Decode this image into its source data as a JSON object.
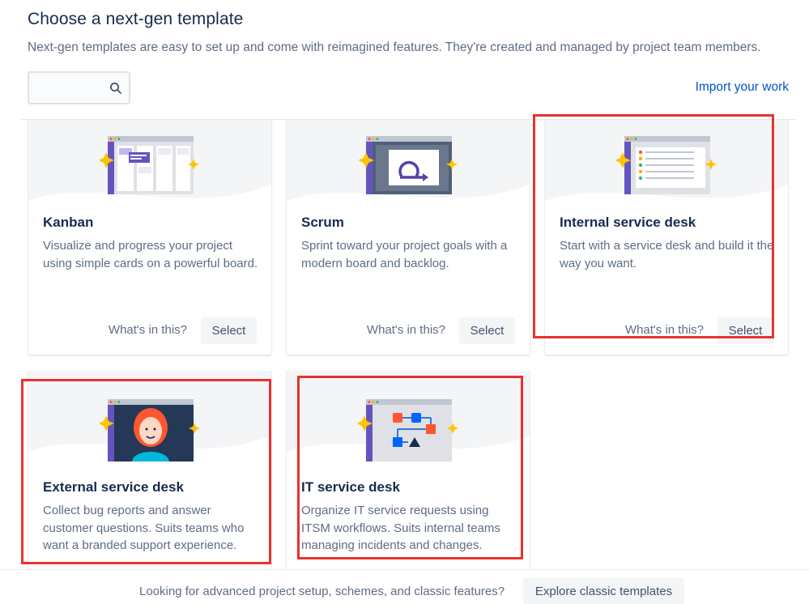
{
  "header": {
    "title": "Choose a next-gen template",
    "subtitle": "Next-gen templates are easy to set up and come with reimagined features. They're created and managed by project team members."
  },
  "search": {
    "value": "",
    "placeholder": "",
    "icon": "search-icon"
  },
  "import_link": "Import your work",
  "cards": [
    {
      "title": "Kanban",
      "description": "Visualize and progress your project using simple cards on a powerful board.",
      "whats_in": "What's in this?",
      "select": "Select",
      "icon": "kanban-board-illustration"
    },
    {
      "title": "Scrum",
      "description": "Sprint toward your project goals with a modern board and backlog.",
      "whats_in": "What's in this?",
      "select": "Select",
      "icon": "scrum-sprint-illustration"
    },
    {
      "title": "Internal service desk",
      "description": "Start with a service desk and build it the way you want.",
      "whats_in": "What's in this?",
      "select": "Select",
      "icon": "service-desk-list-illustration"
    },
    {
      "title": "External service desk",
      "description": "Collect bug reports and answer customer questions. Suits teams who want a branded support experience.",
      "icon": "customer-avatar-illustration"
    },
    {
      "title": "IT service desk",
      "description": "Organize IT service requests using ITSM workflows. Suits internal teams managing incidents and changes.",
      "icon": "workflow-diagram-illustration"
    }
  ],
  "footer": {
    "text": "Looking for advanced project setup, schemes, and classic features?",
    "button": "Explore classic templates"
  },
  "colors": {
    "highlight": "#E8322D",
    "link": "#0052CC",
    "sparkle": "#FFC400",
    "purple": "#6554C0",
    "navy": "#253858"
  }
}
